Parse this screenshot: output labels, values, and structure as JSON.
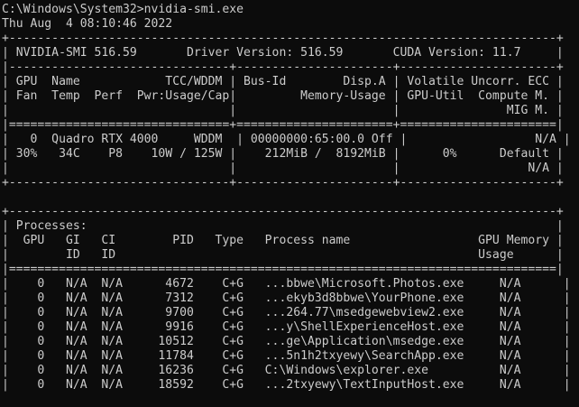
{
  "terminal": {
    "lines": [
      "C:\\Windows\\System32>nvidia-smi.exe",
      "Thu Aug  4 08:10:46 2022",
      "+-----------------------------------------------------------------------------+",
      "| NVIDIA-SMI 516.59       Driver Version: 516.59       CUDA Version: 11.7     |",
      "|-------------------------------+----------------------+----------------------+",
      "| GPU  Name            TCC/WDDM | Bus-Id        Disp.A | Volatile Uncorr. ECC |",
      "| Fan  Temp  Perf  Pwr:Usage/Cap|         Memory-Usage | GPU-Util  Compute M. |",
      "|                               |                      |               MIG M. |",
      "|===============================+======================+======================|",
      "|   0  Quadro RTX 4000     WDDM  | 00000000:65:00.0 Off |                  N/A |",
      "| 30%   34C    P8    10W / 125W |    212MiB /  8192MiB |      0%      Default |",
      "|                               |                      |                  N/A |",
      "+-------------------------------+----------------------+----------------------+",
      "",
      "+-----------------------------------------------------------------------------+",
      "| Processes:                                                                  |",
      "|  GPU   GI   CI        PID   Type   Process name                  GPU Memory |",
      "|        ID   ID                                                   Usage      |",
      "|=============================================================================|",
      "|    0   N/A  N/A      4672    C+G   ...bbwe\\Microsoft.Photos.exe     N/A      |",
      "|    0   N/A  N/A      7312    C+G   ...ekyb3d8bbwe\\YourPhone.exe     N/A      |",
      "|    0   N/A  N/A      9700    C+G   ...264.77\\msedgewebview2.exe     N/A      |",
      "|    0   N/A  N/A      9916    C+G   ...y\\ShellExperienceHost.exe     N/A      |",
      "|    0   N/A  N/A     10512    C+G   ...ge\\Application\\msedge.exe     N/A      |",
      "|    0   N/A  N/A     11784    C+G   ...5n1h2txyewy\\SearchApp.exe     N/A      |",
      "|    0   N/A  N/A     16236    C+G   C:\\Windows\\explorer.exe          N/A      |",
      "|    0   N/A  N/A     18592    C+G   ...2txyewy\\TextInputHost.exe     N/A      |"
    ]
  }
}
